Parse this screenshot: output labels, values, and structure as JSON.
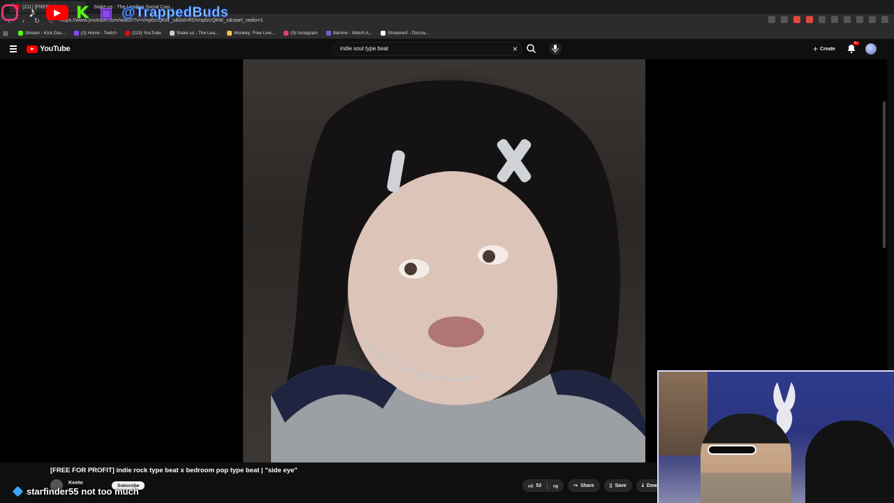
{
  "browser": {
    "tabs": [
      {
        "label": "(211) [FREE FO...",
        "active": true
      },
      {
        "label": "Stake.us - The Leading Social Casi...",
        "active": false
      }
    ],
    "url": "https://www.youtube.com/watch?v=VnpfzcQkW_s&list=RDVnpfzcQkW_s&start_radio=1",
    "bookmarks": [
      {
        "label": "Stream - Kick Das...",
        "color": "#53fc18"
      },
      {
        "label": "(3) Home - Twitch",
        "color": "#9146ff"
      },
      {
        "label": "(113) YouTube",
        "color": "#ff0000"
      },
      {
        "label": "Stake.us - The Lea...",
        "color": "#cccccc"
      },
      {
        "label": "Monkey: Free Live...",
        "color": "#f5c04a"
      },
      {
        "label": "(9) Instagram",
        "color": "#e03b7a"
      },
      {
        "label": "9anime - Watch A...",
        "color": "#7b5cd6"
      },
      {
        "label": "StreameX - Discov...",
        "color": "#ffffff"
      }
    ]
  },
  "overlay": {
    "handle": "@TrappedBuds"
  },
  "youtube": {
    "logo_text": "YouTube",
    "search_value": "indie soul type beat",
    "create_label": "Create",
    "notification_badge": "9+",
    "video_title": "[FREE FOR PROFIT] indie rock type beat x bedroom pop type beat | \"side eye\"",
    "channel_name": "Keeto",
    "subscribe_label": "Subscribe",
    "like_count": "53",
    "share_label": "Share",
    "save_label": "Save",
    "download_label": "Dow"
  },
  "chat": {
    "username": "starfinder55",
    "message": "not too much"
  },
  "colors": {
    "yt_red": "#ff0000",
    "background": "#0f0f0f",
    "handle_color": "#8fd3ff"
  }
}
